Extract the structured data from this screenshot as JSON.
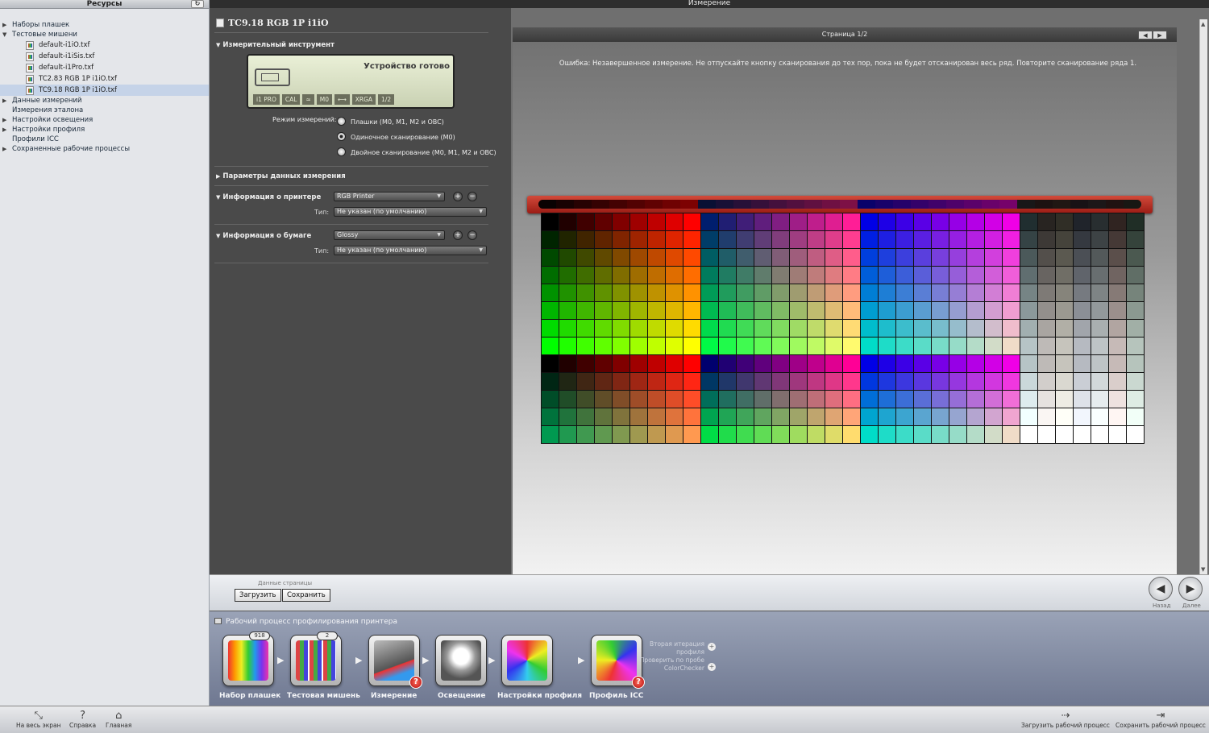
{
  "window": {
    "title": "Измерение"
  },
  "sidebar": {
    "title": "Ресурсы",
    "refresh_icon": "refresh-icon",
    "items": [
      {
        "label": "Наборы плашек",
        "expanded": false
      },
      {
        "label": "Тестовые мишени",
        "expanded": true
      },
      {
        "label": "Данные измерений",
        "expanded": false
      },
      {
        "label": "Измерения эталона",
        "expanded": null
      },
      {
        "label": "Настройки освещения",
        "expanded": false
      },
      {
        "label": "Настройки профиля",
        "expanded": false
      },
      {
        "label": "Профили ICC",
        "expanded": null
      },
      {
        "label": "Сохраненные рабочие процессы",
        "expanded": false
      }
    ],
    "files": [
      {
        "label": "default-i1iO.txf",
        "selected": false
      },
      {
        "label": "default-i1iSis.txf",
        "selected": false
      },
      {
        "label": "default-i1Pro.txf",
        "selected": false
      },
      {
        "label": "TC2.83 RGB 1P i1iO.txf",
        "selected": false
      },
      {
        "label": "TC9.18 RGB 1P i1iO.txf",
        "selected": true
      }
    ]
  },
  "control": {
    "doc_title": "TC9.18 RGB 1P i1iO",
    "instrument": {
      "header": "Измерительный инструмент",
      "status": "Устройство готово",
      "strip": [
        "i1 PRO",
        "CAL",
        "≃",
        "M0",
        "⟷",
        "XRGA",
        "1/2"
      ],
      "mode_label": "Режим измерений:",
      "modes": [
        "Плашки (M0, M1, M2 и OBC)",
        "Одиночное сканирование (M0)",
        "Двойное сканирование (M0, M1, M2 и OBC)"
      ],
      "selected_mode": 1
    },
    "data_params": {
      "header": "Параметры данных измерения"
    },
    "printer": {
      "header": "Информация о принтере",
      "value": "RGB Printer",
      "type_label": "Тип:",
      "type_value": "Не указан (по умолчанию)"
    },
    "paper": {
      "header": "Информация о бумаге",
      "value": "Glossy",
      "type_label": "Тип:",
      "type_value": "Не указан (по умолчанию)"
    }
  },
  "preview": {
    "page_label": "Страница 1/2",
    "error": "Ошибка: Незавершенное измерение. Не отпускайте кнопку сканирования до тех пор, пока не будет отсканирован весь ряд. Повторите сканирование ряда 1.",
    "grid_cols": 34,
    "grid_rows": 13
  },
  "page_strip": {
    "label": "Данные страницы",
    "load": "Загрузить",
    "save": "Сохранить",
    "back": "Назад",
    "next": "Далее"
  },
  "workflow": {
    "title": "Рабочий процесс профилирования принтера",
    "steps": [
      {
        "label": "Набор плашек",
        "badge": "918",
        "error": false
      },
      {
        "label": "Тестовая мишень",
        "badge": "2",
        "error": false
      },
      {
        "label": "Измерение",
        "badge": "",
        "error": true
      },
      {
        "label": "Освещение",
        "badge": "",
        "error": false
      },
      {
        "label": "Настройки профиля",
        "badge": "",
        "error": false
      },
      {
        "label": "Профиль ICC",
        "badge": "",
        "error": true
      }
    ],
    "options": [
      "Вторая итерация профиля",
      "Проверить по пробе ColorChecker"
    ]
  },
  "footer": {
    "fullscreen": "На весь экран",
    "help": "Справка",
    "home": "Главная",
    "load_workflow": "Загрузить рабочий процесс",
    "save_workflow": "Сохранить рабочий процесс"
  }
}
